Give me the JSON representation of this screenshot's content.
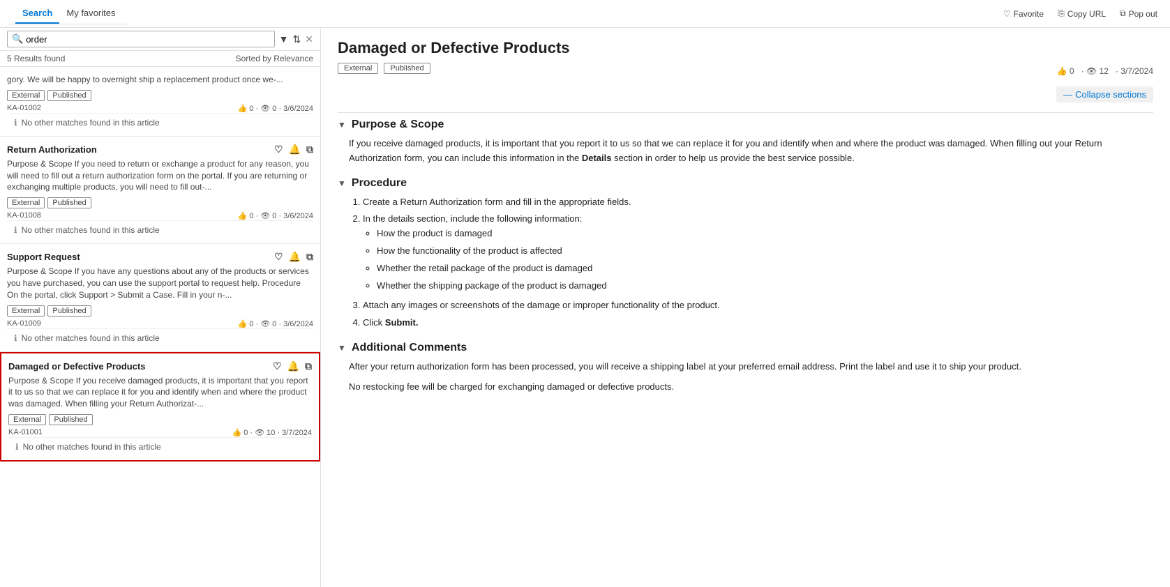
{
  "tabs": {
    "search_label": "Search",
    "favorites_label": "My favorites"
  },
  "top_actions": {
    "favorite_label": "Favorite",
    "copy_label": "Copy URL",
    "popout_label": "Pop out"
  },
  "search": {
    "placeholder": "order",
    "results_count": "5 Results found",
    "sorted_by": "Sorted by Relevance"
  },
  "results": [
    {
      "id": "r1",
      "title": "",
      "excerpt": "gory. We will be happy to overnight ship a replacement product once we-...",
      "tags": [
        "External",
        "Published"
      ],
      "ka": "KA-01002",
      "likes": "0",
      "views": "0",
      "date": "3/6/2024",
      "no_match": "No other matches found in this article",
      "selected": false
    },
    {
      "id": "r2",
      "title": "Return Authorization",
      "excerpt": "Purpose & Scope If you need to return or exchange a product for any reason, you will need to fill out a return authorization form on the portal. If you are returning or exchanging multiple products, you will need to fill out-...",
      "tags": [
        "External",
        "Published"
      ],
      "ka": "KA-01008",
      "likes": "0",
      "views": "0",
      "date": "3/6/2024",
      "no_match": "No other matches found in this article",
      "selected": false
    },
    {
      "id": "r3",
      "title": "Support Request",
      "excerpt": "Purpose & Scope If you have any questions about any of the products or services you have purchased, you can use the support portal to request help. Procedure On the portal, click Support > Submit a Case. Fill in your n-...",
      "tags": [
        "External",
        "Published"
      ],
      "ka": "KA-01009",
      "likes": "0",
      "views": "0",
      "date": "3/6/2024",
      "no_match": "No other matches found in this article",
      "selected": false
    },
    {
      "id": "r4",
      "title": "Damaged or Defective Products",
      "excerpt": "Purpose & Scope If you receive damaged products, it is important that you report it to us so that we can replace it for you and identify when and where the product was damaged. When filling your Return Authorizat-...",
      "tags": [
        "External",
        "Published"
      ],
      "ka": "KA-01001",
      "likes": "0",
      "views": "10",
      "date": "3/7/2024",
      "no_match": "No other matches found in this article",
      "selected": true
    }
  ],
  "article": {
    "title": "Damaged or Defective Products",
    "badges": [
      "External",
      "Published"
    ],
    "likes": "0",
    "views": "12",
    "date": "3/7/2024",
    "collapse_sections_label": "Collapse sections",
    "sections": [
      {
        "id": "s1",
        "heading": "Purpose & Scope",
        "content_paragraphs": [
          "If you receive damaged products, it is important that you report it to us so that we can replace it for you and identify when and where the product was damaged. When filling out your Return Authorization form, you can include this information in the Details section in order to help us provide the best service possible."
        ],
        "bold_words": [
          "Details"
        ]
      },
      {
        "id": "s2",
        "heading": "Procedure",
        "ordered_items": [
          "Create a Return Authorization form and fill in the appropriate fields.",
          "In the details section, include the following information:"
        ],
        "sub_bullets": [
          "How the product is damaged",
          "How the functionality of the product is affected",
          "Whether the retail package of the product is damaged",
          "Whether the shipping package of the product is damaged"
        ],
        "ordered_items_continued": [
          "Attach any images or screenshots of the damage or improper functionality of the product.",
          "Click Submit."
        ],
        "bold_in_continued": [
          "Submit"
        ]
      },
      {
        "id": "s3",
        "heading": "Additional Comments",
        "content_paragraphs": [
          "After your return authorization form has been processed, you will receive a shipping label at your preferred email address. Print the label and use it to ship your product.",
          "No restocking fee will be charged for exchanging damaged or defective products."
        ]
      }
    ]
  }
}
